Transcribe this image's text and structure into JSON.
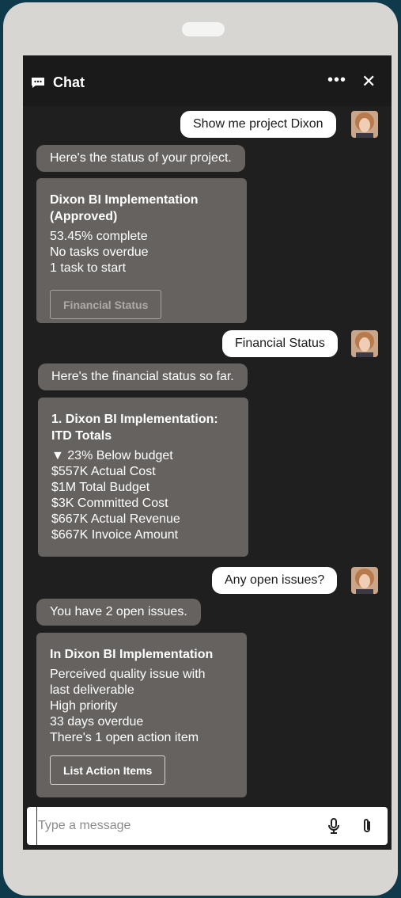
{
  "header": {
    "title": "Chat",
    "more_icon": "ellipsis-icon",
    "close_icon": "close-icon",
    "chat_icon": "chat-bubble-icon"
  },
  "messages": {
    "user1": "Show me project Dixon",
    "bot1": "Here's the status of your project.",
    "card1": {
      "title": "Dixon BI Implementation (Approved)",
      "lines": [
        "53.45% complete",
        "No tasks overdue",
        "1 task to start"
      ],
      "button": "Financial Status"
    },
    "user2": "Financial Status",
    "bot2": "Here's the financial status so far.",
    "card2": {
      "title": "1. Dixon BI Implementation: ITD Totals",
      "lines": [
        "▼ 23% Below budget",
        "$557K Actual Cost",
        "$1M Total Budget",
        "$3K Committed Cost",
        "$667K Actual Revenue",
        "$667K Invoice Amount"
      ]
    },
    "user3": "Any open issues?",
    "bot3": "You have 2 open issues.",
    "card3": {
      "title": "In Dixon BI Implementation",
      "lines": [
        "Perceived quality issue with",
        "last deliverable",
        "High priority",
        "33 days overdue",
        "There's 1 open action item"
      ],
      "button": "List Action Items"
    }
  },
  "composer": {
    "placeholder": "Type a message",
    "mic_icon": "microphone-icon",
    "attach_icon": "paperclip-icon"
  }
}
